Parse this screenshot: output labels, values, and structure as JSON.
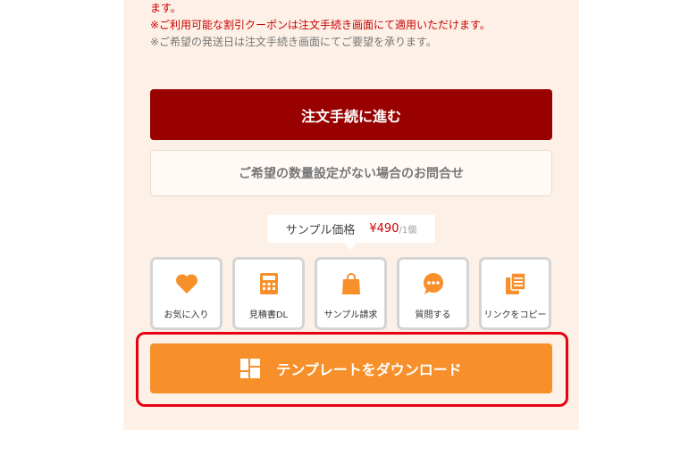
{
  "notes": {
    "line1": "ます。",
    "line2": "※ご利用可能な割引クーポンは注文手続き画面にて適用いただけます。",
    "line3": "※ご希望の発送日は注文手続き画面にてご要望を承ります。"
  },
  "order_button": {
    "label": "注文手続に進む"
  },
  "inquiry_button": {
    "label": "ご希望の数量設定がない場合のお問合せ"
  },
  "sample": {
    "label": "サンプル価格",
    "price": "¥490",
    "unit": "/1個"
  },
  "actions": [
    {
      "label": "お気に入り",
      "icon": "heart-icon"
    },
    {
      "label": "見積書DL",
      "icon": "calculator-icon"
    },
    {
      "label": "サンプル請求",
      "icon": "shopping-bag-icon"
    },
    {
      "label": "質問する",
      "icon": "chat-bubble-icon"
    },
    {
      "label": "リンクをコピー",
      "icon": "copy-icon"
    }
  ],
  "download_button": {
    "label": "テンプレートをダウンロード",
    "icon": "template-grid-icon"
  },
  "colors": {
    "accent_orange": "#f7902a",
    "order_red": "#990000",
    "highlight_red": "#e60012",
    "panel_bg": "#fdf0e6"
  }
}
